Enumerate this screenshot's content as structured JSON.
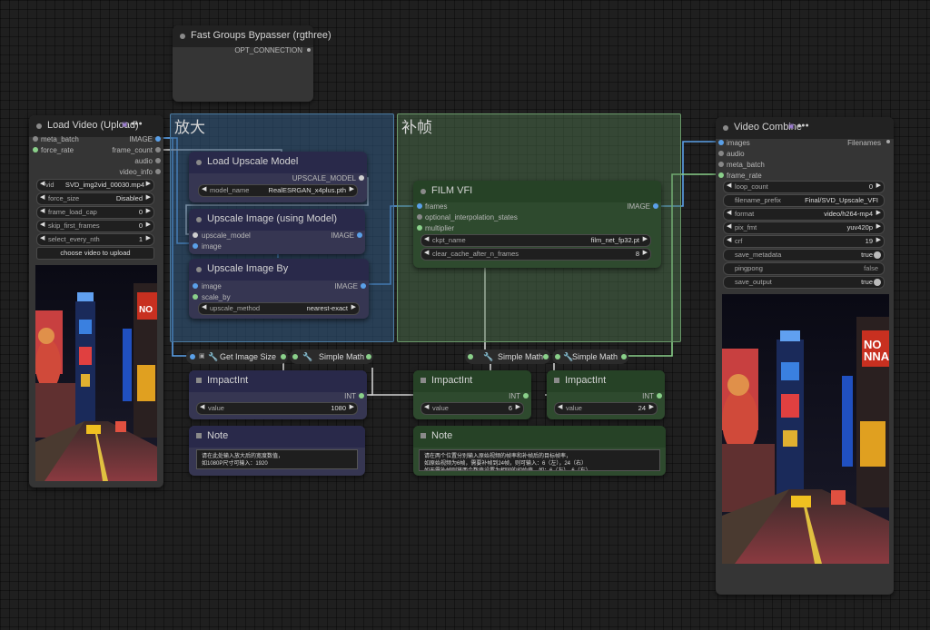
{
  "colors": {
    "link_blue": "#5aa0e8",
    "link_green": "#8ad08a",
    "link_white": "#d0d0d0",
    "group_blue": "#2a4a66",
    "group_green": "#3c5a3c"
  },
  "groups": [
    {
      "title": "放大"
    },
    {
      "title": "补帧"
    }
  ],
  "fast_groups": {
    "title": "Fast Groups Bypasser (rgthree)",
    "output": "OPT_CONNECTION"
  },
  "load_video": {
    "title": "Load Video (Upload)",
    "inputs": [
      "meta_batch",
      "force_rate"
    ],
    "outputs": [
      "IMAGE",
      "frame_count",
      "audio",
      "video_info"
    ],
    "widgets": [
      {
        "label": "vid",
        "value": "SVD_img2vid_00030.mp4"
      },
      {
        "label": "force_size",
        "value": "Disabled"
      },
      {
        "label": "frame_load_cap",
        "value": "0"
      },
      {
        "label": "skip_first_frames",
        "value": "0"
      },
      {
        "label": "select_every_nth",
        "value": "1"
      }
    ],
    "upload_button": "choose video to upload"
  },
  "load_upscale_model": {
    "title": "Load Upscale Model",
    "output": "UPSCALE_MODEL",
    "widget": {
      "label": "model_name",
      "value": "RealESRGAN_x4plus.pth"
    }
  },
  "upscale_image_model": {
    "title": "Upscale Image (using Model)",
    "inputs": [
      "upscale_model",
      "image"
    ],
    "output": "IMAGE"
  },
  "upscale_image_by": {
    "title": "Upscale Image By",
    "inputs": [
      "image",
      "scale_by"
    ],
    "output": "IMAGE",
    "widget": {
      "label": "upscale_method",
      "value": "nearest-exact"
    }
  },
  "film_vfi": {
    "title": "FILM VFI",
    "inputs": [
      "frames",
      "optional_interpolation_states",
      "multiplier"
    ],
    "output": "IMAGE",
    "widgets": [
      {
        "label": "ckpt_name",
        "value": "film_net_fp32.pt"
      },
      {
        "label": "clear_cache_after_n_frames",
        "value": "8"
      }
    ]
  },
  "bars": {
    "get_image_size": "Get Image Size",
    "simple_math_1": "Simple Math",
    "simple_math_2": "Simple Math",
    "simple_math_3": "Simple Math"
  },
  "impact_ints": [
    {
      "title": "ImpactInt",
      "output": "INT",
      "label": "value",
      "value": "1080"
    },
    {
      "title": "ImpactInt",
      "output": "INT",
      "label": "value",
      "value": "6"
    },
    {
      "title": "ImpactInt",
      "output": "INT",
      "label": "value",
      "value": "24"
    }
  ],
  "notes": [
    {
      "title": "Note",
      "text": "请在此处输入放大后的宽度数值，\n如1080P尺寸可输入：1920"
    },
    {
      "title": "Note",
      "text": "请在两个位置分别输入原始视频的帧率和补帧后的目标帧率，\n如原始视频为6帧，需要补帧到24帧，则可输入：6（左），24（右）\n如无需补帧则将两个数值设置为相同的初始值，如：6（左），6（右）"
    }
  ],
  "video_combine": {
    "title": "Video Combine",
    "inputs": [
      "images",
      "audio",
      "meta_batch",
      "frame_rate"
    ],
    "output": "Filenames",
    "widgets": [
      {
        "label": "loop_count",
        "value": "0"
      },
      {
        "label": "filename_prefix",
        "value": "Final/SVD_Upscale_VFI"
      },
      {
        "label": "format",
        "value": "video/h264-mp4"
      },
      {
        "label": "pix_fmt",
        "value": "yuv420p"
      },
      {
        "label": "crf",
        "value": "19"
      },
      {
        "label": "save_metadata",
        "value": "true"
      },
      {
        "label": "pingpong",
        "value": "false"
      },
      {
        "label": "save_output",
        "value": "true"
      }
    ]
  },
  "preview_signs": {
    "left": "NO",
    "right": "NO\nNNA"
  }
}
